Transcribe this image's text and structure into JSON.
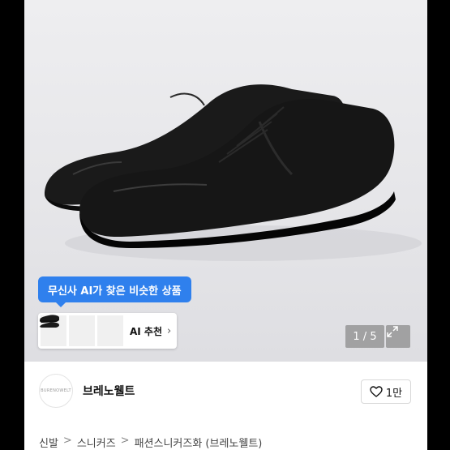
{
  "ai_banner": {
    "text": "무신사 AI가 찾은 비슷한 상품"
  },
  "ai_card": {
    "label": "AI 추천",
    "chevron": "›"
  },
  "gallery": {
    "counter": "1 / 5",
    "expand_icon": "expand-icon"
  },
  "brand": {
    "logo_text": "BURENOWELT",
    "name": "브레노웰트",
    "like_count": "1만",
    "like_icon": "heart-icon"
  },
  "breadcrumb": {
    "items": [
      "신발",
      "스니커즈",
      "패션스니커즈화 (브레노웰트)"
    ],
    "separator": ">"
  },
  "colors": {
    "accent": "#2f80ed",
    "shoe": "#141414"
  }
}
